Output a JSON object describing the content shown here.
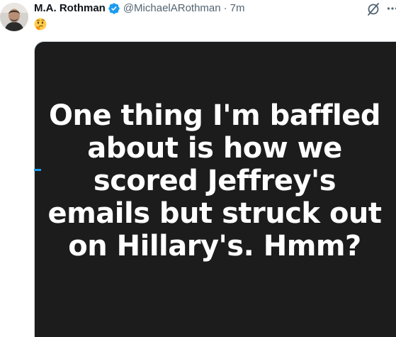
{
  "tweet": {
    "author": {
      "display_name": "M.A. Rothman",
      "handle": "@MichaelARothman",
      "verified": true,
      "avatar": "profile-photo"
    },
    "separator": "·",
    "timestamp": "7m",
    "emoji": "thinking-face",
    "actions": {
      "grok_icon": "grok-icon",
      "more_icon": "more-icon"
    },
    "media": {
      "type": "image",
      "background_color": "#1c1c1c",
      "text_color": "#ffffff",
      "lines": [
        "One thing I'm baffled",
        "about is how we",
        "scored Jeffrey's",
        "emails but struck out",
        "on Hillary's. Hmm?"
      ]
    }
  },
  "colors": {
    "verified_badge": "#1d9bf0",
    "secondary_text": "#536471",
    "primary_text": "#0f1419"
  }
}
